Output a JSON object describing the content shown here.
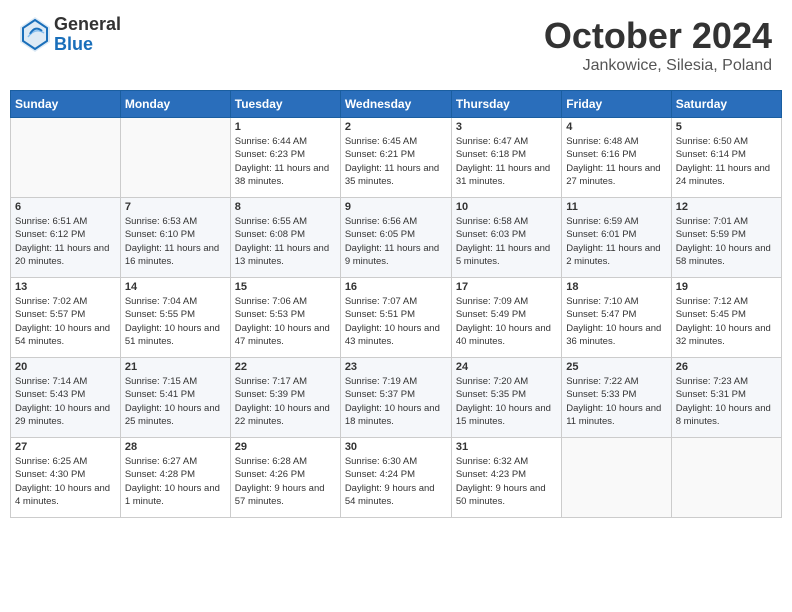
{
  "header": {
    "logo_general": "General",
    "logo_blue": "Blue",
    "month_title": "October 2024",
    "location": "Jankowice, Silesia, Poland"
  },
  "days_of_week": [
    "Sunday",
    "Monday",
    "Tuesday",
    "Wednesday",
    "Thursday",
    "Friday",
    "Saturday"
  ],
  "weeks": [
    [
      {
        "day": "",
        "sunrise": "",
        "sunset": "",
        "daylight": ""
      },
      {
        "day": "",
        "sunrise": "",
        "sunset": "",
        "daylight": ""
      },
      {
        "day": "1",
        "sunrise": "Sunrise: 6:44 AM",
        "sunset": "Sunset: 6:23 PM",
        "daylight": "Daylight: 11 hours and 38 minutes."
      },
      {
        "day": "2",
        "sunrise": "Sunrise: 6:45 AM",
        "sunset": "Sunset: 6:21 PM",
        "daylight": "Daylight: 11 hours and 35 minutes."
      },
      {
        "day": "3",
        "sunrise": "Sunrise: 6:47 AM",
        "sunset": "Sunset: 6:18 PM",
        "daylight": "Daylight: 11 hours and 31 minutes."
      },
      {
        "day": "4",
        "sunrise": "Sunrise: 6:48 AM",
        "sunset": "Sunset: 6:16 PM",
        "daylight": "Daylight: 11 hours and 27 minutes."
      },
      {
        "day": "5",
        "sunrise": "Sunrise: 6:50 AM",
        "sunset": "Sunset: 6:14 PM",
        "daylight": "Daylight: 11 hours and 24 minutes."
      }
    ],
    [
      {
        "day": "6",
        "sunrise": "Sunrise: 6:51 AM",
        "sunset": "Sunset: 6:12 PM",
        "daylight": "Daylight: 11 hours and 20 minutes."
      },
      {
        "day": "7",
        "sunrise": "Sunrise: 6:53 AM",
        "sunset": "Sunset: 6:10 PM",
        "daylight": "Daylight: 11 hours and 16 minutes."
      },
      {
        "day": "8",
        "sunrise": "Sunrise: 6:55 AM",
        "sunset": "Sunset: 6:08 PM",
        "daylight": "Daylight: 11 hours and 13 minutes."
      },
      {
        "day": "9",
        "sunrise": "Sunrise: 6:56 AM",
        "sunset": "Sunset: 6:05 PM",
        "daylight": "Daylight: 11 hours and 9 minutes."
      },
      {
        "day": "10",
        "sunrise": "Sunrise: 6:58 AM",
        "sunset": "Sunset: 6:03 PM",
        "daylight": "Daylight: 11 hours and 5 minutes."
      },
      {
        "day": "11",
        "sunrise": "Sunrise: 6:59 AM",
        "sunset": "Sunset: 6:01 PM",
        "daylight": "Daylight: 11 hours and 2 minutes."
      },
      {
        "day": "12",
        "sunrise": "Sunrise: 7:01 AM",
        "sunset": "Sunset: 5:59 PM",
        "daylight": "Daylight: 10 hours and 58 minutes."
      }
    ],
    [
      {
        "day": "13",
        "sunrise": "Sunrise: 7:02 AM",
        "sunset": "Sunset: 5:57 PM",
        "daylight": "Daylight: 10 hours and 54 minutes."
      },
      {
        "day": "14",
        "sunrise": "Sunrise: 7:04 AM",
        "sunset": "Sunset: 5:55 PM",
        "daylight": "Daylight: 10 hours and 51 minutes."
      },
      {
        "day": "15",
        "sunrise": "Sunrise: 7:06 AM",
        "sunset": "Sunset: 5:53 PM",
        "daylight": "Daylight: 10 hours and 47 minutes."
      },
      {
        "day": "16",
        "sunrise": "Sunrise: 7:07 AM",
        "sunset": "Sunset: 5:51 PM",
        "daylight": "Daylight: 10 hours and 43 minutes."
      },
      {
        "day": "17",
        "sunrise": "Sunrise: 7:09 AM",
        "sunset": "Sunset: 5:49 PM",
        "daylight": "Daylight: 10 hours and 40 minutes."
      },
      {
        "day": "18",
        "sunrise": "Sunrise: 7:10 AM",
        "sunset": "Sunset: 5:47 PM",
        "daylight": "Daylight: 10 hours and 36 minutes."
      },
      {
        "day": "19",
        "sunrise": "Sunrise: 7:12 AM",
        "sunset": "Sunset: 5:45 PM",
        "daylight": "Daylight: 10 hours and 32 minutes."
      }
    ],
    [
      {
        "day": "20",
        "sunrise": "Sunrise: 7:14 AM",
        "sunset": "Sunset: 5:43 PM",
        "daylight": "Daylight: 10 hours and 29 minutes."
      },
      {
        "day": "21",
        "sunrise": "Sunrise: 7:15 AM",
        "sunset": "Sunset: 5:41 PM",
        "daylight": "Daylight: 10 hours and 25 minutes."
      },
      {
        "day": "22",
        "sunrise": "Sunrise: 7:17 AM",
        "sunset": "Sunset: 5:39 PM",
        "daylight": "Daylight: 10 hours and 22 minutes."
      },
      {
        "day": "23",
        "sunrise": "Sunrise: 7:19 AM",
        "sunset": "Sunset: 5:37 PM",
        "daylight": "Daylight: 10 hours and 18 minutes."
      },
      {
        "day": "24",
        "sunrise": "Sunrise: 7:20 AM",
        "sunset": "Sunset: 5:35 PM",
        "daylight": "Daylight: 10 hours and 15 minutes."
      },
      {
        "day": "25",
        "sunrise": "Sunrise: 7:22 AM",
        "sunset": "Sunset: 5:33 PM",
        "daylight": "Daylight: 10 hours and 11 minutes."
      },
      {
        "day": "26",
        "sunrise": "Sunrise: 7:23 AM",
        "sunset": "Sunset: 5:31 PM",
        "daylight": "Daylight: 10 hours and 8 minutes."
      }
    ],
    [
      {
        "day": "27",
        "sunrise": "Sunrise: 6:25 AM",
        "sunset": "Sunset: 4:30 PM",
        "daylight": "Daylight: 10 hours and 4 minutes."
      },
      {
        "day": "28",
        "sunrise": "Sunrise: 6:27 AM",
        "sunset": "Sunset: 4:28 PM",
        "daylight": "Daylight: 10 hours and 1 minute."
      },
      {
        "day": "29",
        "sunrise": "Sunrise: 6:28 AM",
        "sunset": "Sunset: 4:26 PM",
        "daylight": "Daylight: 9 hours and 57 minutes."
      },
      {
        "day": "30",
        "sunrise": "Sunrise: 6:30 AM",
        "sunset": "Sunset: 4:24 PM",
        "daylight": "Daylight: 9 hours and 54 minutes."
      },
      {
        "day": "31",
        "sunrise": "Sunrise: 6:32 AM",
        "sunset": "Sunset: 4:23 PM",
        "daylight": "Daylight: 9 hours and 50 minutes."
      },
      {
        "day": "",
        "sunrise": "",
        "sunset": "",
        "daylight": ""
      },
      {
        "day": "",
        "sunrise": "",
        "sunset": "",
        "daylight": ""
      }
    ]
  ]
}
